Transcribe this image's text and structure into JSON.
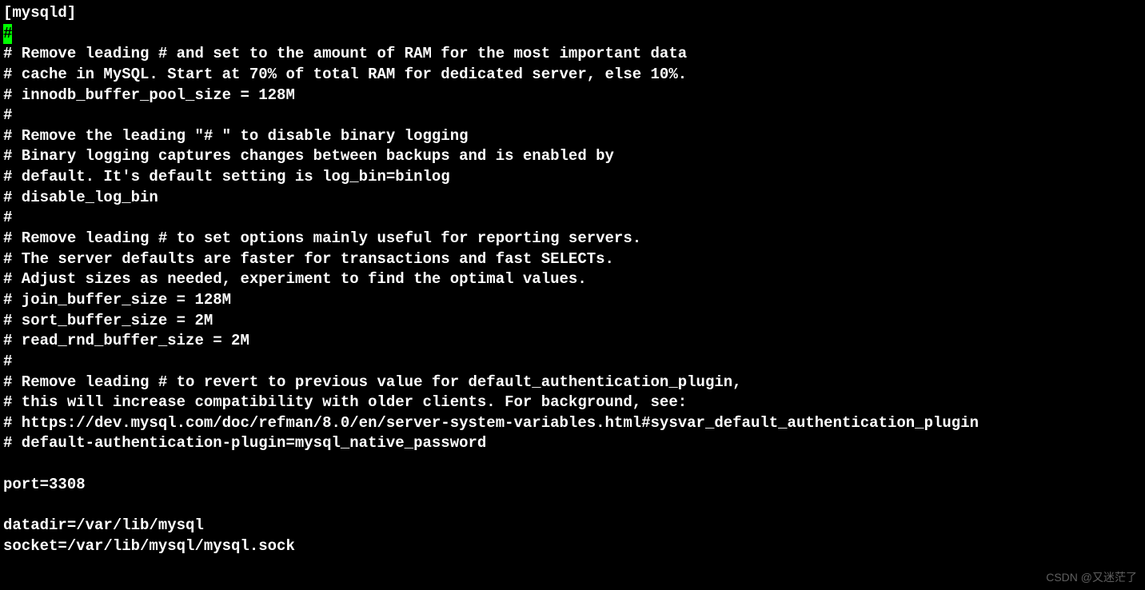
{
  "terminal": {
    "lines": [
      "[mysqld]",
      "",
      "# Remove leading # and set to the amount of RAM for the most important data",
      "# cache in MySQL. Start at 70% of total RAM for dedicated server, else 10%.",
      "# innodb_buffer_pool_size = 128M",
      "#",
      "# Remove the leading \"# \" to disable binary logging",
      "# Binary logging captures changes between backups and is enabled by",
      "# default. It's default setting is log_bin=binlog",
      "# disable_log_bin",
      "#",
      "# Remove leading # to set options mainly useful for reporting servers.",
      "# The server defaults are faster for transactions and fast SELECTs.",
      "# Adjust sizes as needed, experiment to find the optimal values.",
      "# join_buffer_size = 128M",
      "# sort_buffer_size = 2M",
      "# read_rnd_buffer_size = 2M",
      "#",
      "# Remove leading # to revert to previous value for default_authentication_plugin,",
      "# this will increase compatibility with older clients. For background, see:",
      "# https://dev.mysql.com/doc/refman/8.0/en/server-system-variables.html#sysvar_default_authentication_plugin",
      "# default-authentication-plugin=mysql_native_password",
      "",
      "port=3308",
      "",
      "datadir=/var/lib/mysql",
      "socket=/var/lib/mysql/mysql.sock"
    ],
    "cursor_char": "#"
  },
  "watermark": "CSDN @又迷茫了"
}
